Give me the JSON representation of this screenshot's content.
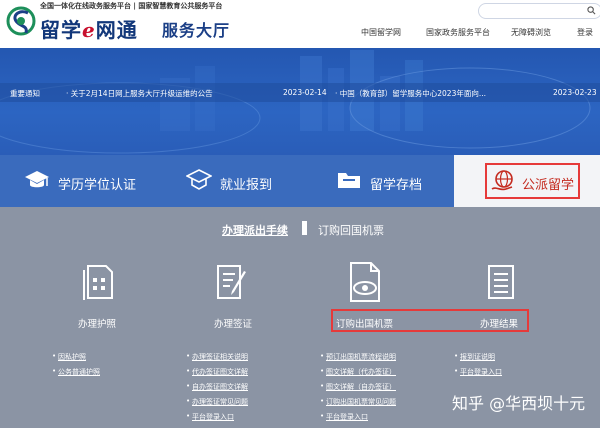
{
  "header": {
    "tagline": "全国一体化在线政务服务平台 | 国家智慧教育公共服务平台",
    "site_name_pre": "留学",
    "site_name_e": "e",
    "site_name_post": "网通",
    "site_subname": "服务大厅",
    "top_links": [
      "中国留学网",
      "国家政务服务平台",
      "无障碍浏览",
      "登录"
    ]
  },
  "notices": {
    "label": "重要通知",
    "items": [
      {
        "text": "· 关于2月14日网上服务大厅升级运维的公告",
        "date": "2023-02-14"
      },
      {
        "text": "· 中国（教育部）留学服务中心2023年面向...",
        "date": "2023-02-23"
      }
    ]
  },
  "tabs": [
    {
      "label": "学历学位认证",
      "icon": "graduation-cap-icon"
    },
    {
      "label": "就业报到",
      "icon": "mortarboard-icon"
    },
    {
      "label": "留学存档",
      "icon": "folder-icon"
    },
    {
      "label": "公派留学",
      "icon": "globe-hand-icon",
      "active": true
    }
  ],
  "subtabs": [
    "办理派出手续",
    "订购回国机票"
  ],
  "cards": [
    {
      "title": "办理护照",
      "icon": "document-icon"
    },
    {
      "title": "办理签证",
      "icon": "form-edit-icon"
    },
    {
      "title": "订购出国机票",
      "icon": "eye-document-icon"
    },
    {
      "title": "办理结果",
      "icon": "list-icon"
    }
  ],
  "links": [
    [
      "因私护照",
      "公务普通护照"
    ],
    [
      "办理签证相关说明",
      "代办签证图文详解",
      "自办签证图文详解",
      "办理签证常见问题",
      "平台登录入口"
    ],
    [
      "预订出国机票流程说明",
      "图文详解（代办签证）",
      "图文详解（自办签证）",
      "订购出国机票常见问题",
      "平台登录入口"
    ],
    [
      "报到证说明",
      "平台登录入口"
    ]
  ],
  "watermark": "知乎 @华西坝十元",
  "colors": {
    "brand_blue": "#1b3f86",
    "highlight_red": "#e63a3a",
    "panel_gray": "#8b94a4"
  }
}
